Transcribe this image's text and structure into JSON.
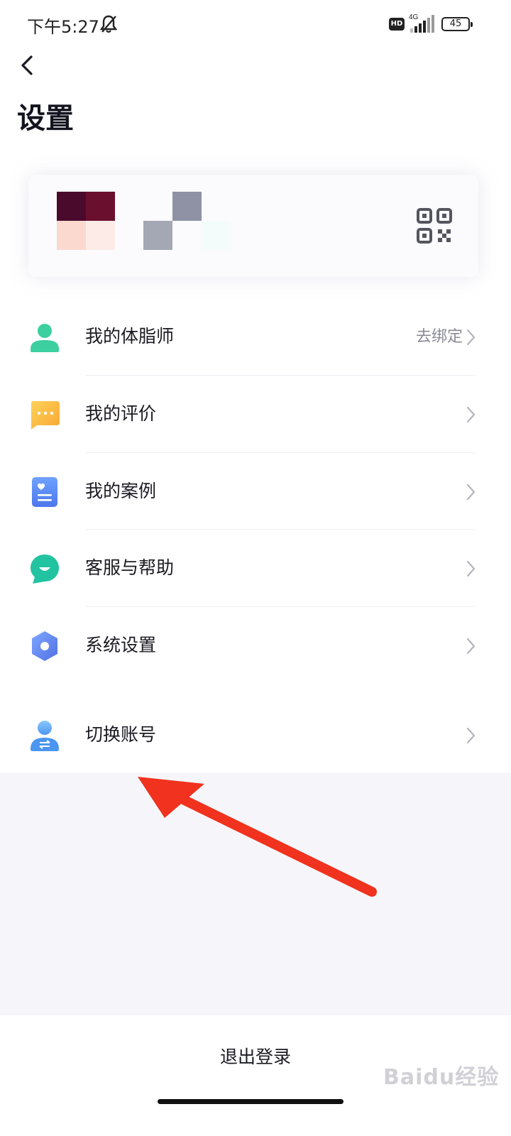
{
  "status_bar": {
    "time": "下午5:27",
    "network_type": "HD",
    "network_gen": "4G",
    "battery": "45",
    "icons": [
      "bell-off-icon",
      "hd-icon",
      "signal-icon",
      "battery-icon"
    ]
  },
  "header": {
    "title": "设置",
    "back_icon": "chevron-left-icon"
  },
  "profile": {
    "avatar": "pixelated-avatar",
    "name": "pixelated",
    "qr_icon": "qr-code-icon"
  },
  "menu": {
    "items": [
      {
        "label": "我的体脂师",
        "right_text": "去绑定",
        "icon": "person-icon",
        "color": "#3ccfa0"
      },
      {
        "label": "我的评价",
        "right_text": "",
        "icon": "chat-bubble-icon",
        "color": "#f7b733"
      },
      {
        "label": "我的案例",
        "right_text": "",
        "icon": "case-card-icon",
        "color": "#5b8cf5"
      },
      {
        "label": "客服与帮助",
        "right_text": "",
        "icon": "service-chat-icon",
        "color": "#22c3a0"
      },
      {
        "label": "系统设置",
        "right_text": "",
        "icon": "hexagon-gear-icon",
        "color": "#6a8ef2"
      }
    ],
    "switch_account": {
      "label": "切换账号",
      "icon": "switch-user-icon",
      "color": "#5aa8f8"
    }
  },
  "annotation": {
    "arrow_color": "#f0321e"
  },
  "footer": {
    "logout_label": "退出登录",
    "watermark": "Baidu经验"
  }
}
